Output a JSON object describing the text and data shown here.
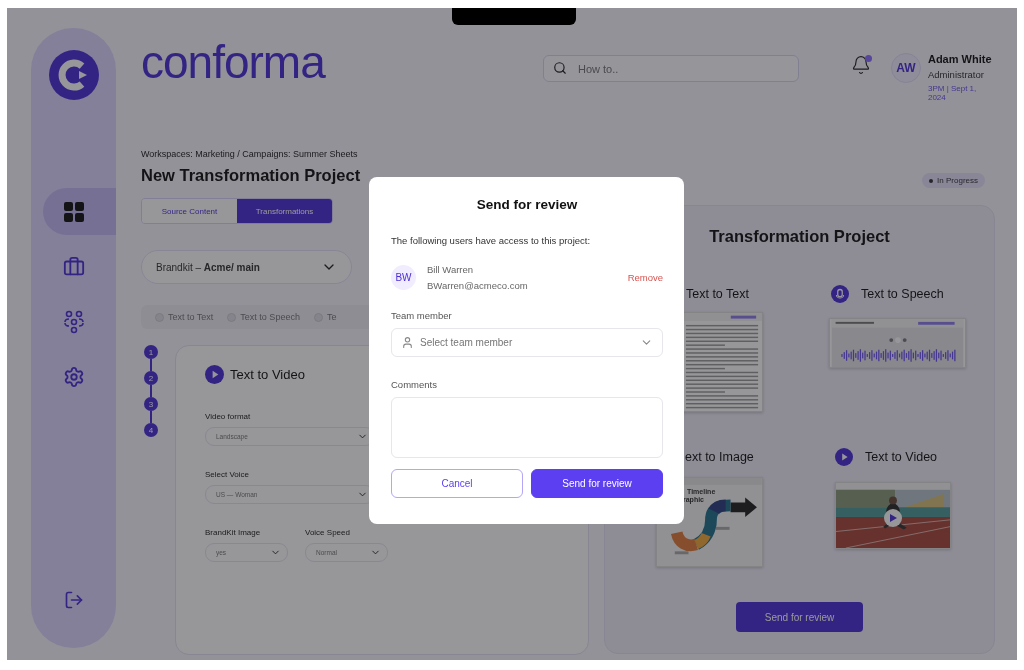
{
  "logo": {
    "text": "conforma"
  },
  "search": {
    "placeholder": "How to.."
  },
  "notifications": {
    "unread": true
  },
  "user": {
    "initials": "AW",
    "name": "Adam White",
    "role": "Administrator",
    "timestamp": "3PM | Sept 1, 2024"
  },
  "sidebar": {
    "items": [
      {
        "selected": true
      },
      {
        "selected": false
      },
      {
        "selected": false
      },
      {
        "selected": false
      }
    ]
  },
  "breadcrumb": "Workspaces: Marketing / Campaigns: Summer Sheets",
  "title": "New Transformation Project",
  "tabs": [
    {
      "label": "Source Content",
      "selected": false
    },
    {
      "label": "Transformations",
      "selected": true
    }
  ],
  "brandkit": "Brandkit – **Acme/ main**",
  "step_filters": [
    "Text to Text",
    "Text to Speech",
    "Te"
  ],
  "steps": [
    "1",
    "2",
    "3",
    "4"
  ],
  "config": {
    "title": "Text to Video",
    "fields": [
      {
        "label": "Video format",
        "value": "Landscape",
        "kind": "wide"
      },
      {
        "label": "Select Voice",
        "value": "US — Woman",
        "kind": "wide"
      },
      {
        "label": "BrandKit Image",
        "value": "yes",
        "kind": "narrow"
      },
      {
        "label": "Voice Speed",
        "value": "Normal",
        "kind": "narrow"
      }
    ]
  },
  "status": "In Progress",
  "project": {
    "title": "Transformation Project",
    "items": [
      {
        "label": "Text to Text",
        "kind": "document"
      },
      {
        "label": "Text to Speech",
        "kind": "audio"
      },
      {
        "label": "ext to Image",
        "caption": [
          "Timeline",
          "raphic"
        ]
      },
      {
        "label": "Text to Video",
        "kind": "video"
      }
    ],
    "button": "Send for review"
  },
  "dialog": {
    "title": "Send for review",
    "intro": "The following users have access to this project:",
    "users": [
      {
        "initials": "BW",
        "name": "Bill Warren",
        "email": "BWarren@acmeco.com",
        "action": "Remove"
      }
    ],
    "member": {
      "label": "Team member",
      "placeholder": "Select team member"
    },
    "comments": {
      "label": "Comments"
    },
    "buttons": [
      {
        "label": "Cancel",
        "kind": "secondary"
      },
      {
        "label": "Send for review",
        "kind": "primary"
      }
    ]
  }
}
